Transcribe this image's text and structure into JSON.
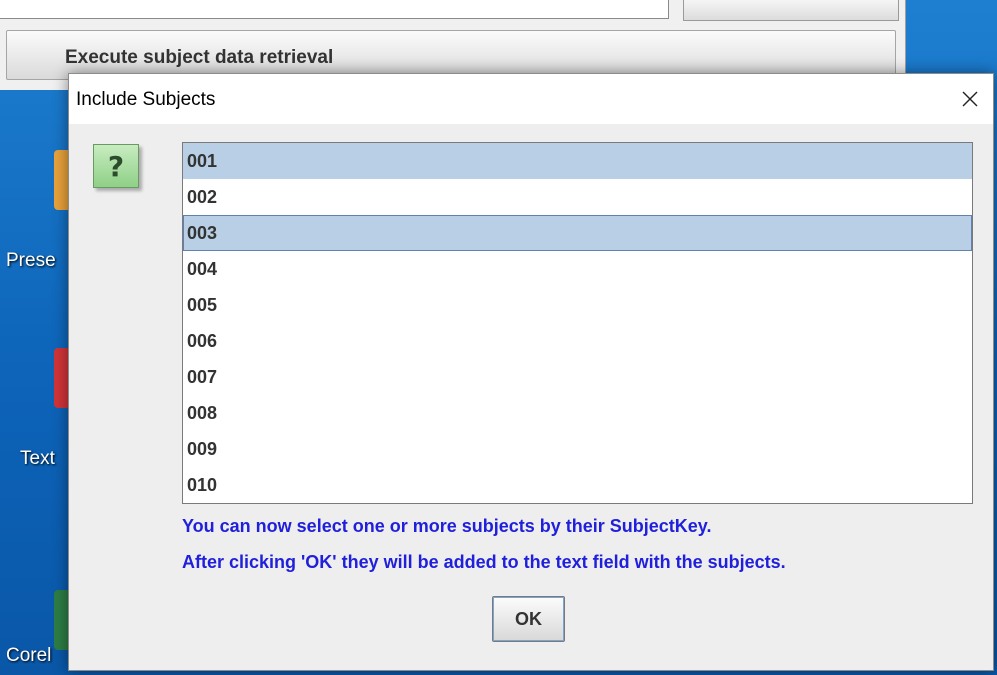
{
  "desktop": {
    "icons": [
      {
        "label": "Prese",
        "color": "#e8a23b"
      },
      {
        "label": "Text",
        "color": "#d13438"
      },
      {
        "label": "Corel",
        "color": "#2d7d46"
      }
    ]
  },
  "background_window": {
    "execute_button_label": "Execute subject data retrieval"
  },
  "dialog": {
    "title": "Include Subjects",
    "close_icon": "close-icon",
    "question_icon": "question-mark-icon",
    "question_glyph": "?",
    "subjects": [
      {
        "key": "001",
        "selected": true,
        "focused": false
      },
      {
        "key": "002",
        "selected": false,
        "focused": false
      },
      {
        "key": "003",
        "selected": true,
        "focused": true
      },
      {
        "key": "004",
        "selected": false,
        "focused": false
      },
      {
        "key": "005",
        "selected": false,
        "focused": false
      },
      {
        "key": "006",
        "selected": false,
        "focused": false
      },
      {
        "key": "007",
        "selected": false,
        "focused": false
      },
      {
        "key": "008",
        "selected": false,
        "focused": false
      },
      {
        "key": "009",
        "selected": false,
        "focused": false
      },
      {
        "key": "010",
        "selected": false,
        "focused": false
      }
    ],
    "info_line_1": "You can now select one or more subjects by their SubjectKey.",
    "info_line_2": "After clicking 'OK' they will be added to the text field with the subjects.",
    "ok_label": "OK"
  },
  "colors": {
    "selection": "#b8cfe5",
    "info_text": "#1f1fdc",
    "desktop": "#0d64b9"
  }
}
